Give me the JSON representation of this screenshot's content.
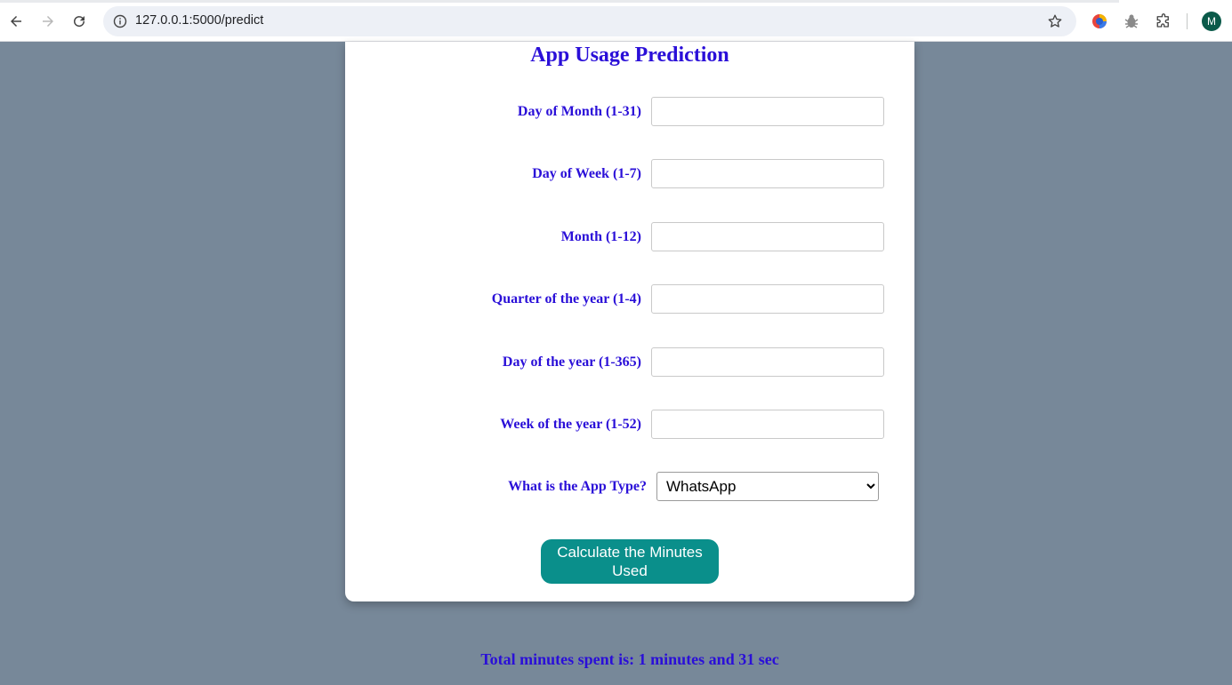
{
  "browser": {
    "url": "127.0.0.1:5000/predict",
    "avatar_letter": "M",
    "icons": {
      "back": "arrow-left-icon",
      "forward": "arrow-right-icon",
      "reload": "reload-icon",
      "site_info": "info-icon",
      "bookmark": "star-icon",
      "ext1": "colorful-circle-extension-icon",
      "ext2": "bug-extension-icon",
      "extensions": "puzzle-icon"
    }
  },
  "form": {
    "title": "App Usage Prediction",
    "fields": [
      {
        "label": "Day of Month (1-31)",
        "value": ""
      },
      {
        "label": "Day of Week (1-7)",
        "value": ""
      },
      {
        "label": "Month (1-12)",
        "value": ""
      },
      {
        "label": "Quarter of the year (1-4)",
        "value": ""
      },
      {
        "label": "Day of the year (1-365)",
        "value": ""
      },
      {
        "label": "Week of the year (1-52)",
        "value": ""
      }
    ],
    "app_type": {
      "label": "What is the App Type?",
      "selected": "WhatsApp"
    },
    "submit_label": "Calculate the Minutes Used"
  },
  "result": {
    "text": "Total minutes spent is: 1 minutes and 31 sec"
  },
  "colors": {
    "background": "#778899",
    "label": "#2a0fd8",
    "button": "#0a8f8b"
  }
}
